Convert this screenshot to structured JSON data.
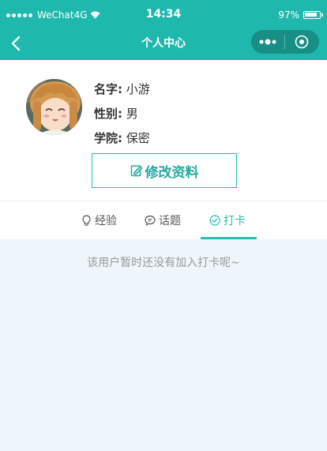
{
  "status_bar": {
    "carrier": "WeChat4G",
    "time": "14:34",
    "battery": "97%"
  },
  "nav": {
    "title": "个人中心"
  },
  "profile": {
    "name_key": "名字:",
    "name_value": "小游",
    "gender_key": "性别:",
    "gender_value": "男",
    "college_key": "学院:",
    "college_value": "保密",
    "edit_button": "修改资料"
  },
  "tabs": [
    {
      "label": "经验",
      "icon": "lightbulb-icon"
    },
    {
      "label": "话题",
      "icon": "chat-bubble-icon"
    },
    {
      "label": "打卡",
      "icon": "check-circle-icon",
      "active": true
    }
  ],
  "content": {
    "empty_message": "该用户暂时还没有加入打卡呢~"
  },
  "colors": {
    "accent": "#1fb8ad",
    "capsule": "#178f86",
    "page_bg": "#eef5fb"
  }
}
